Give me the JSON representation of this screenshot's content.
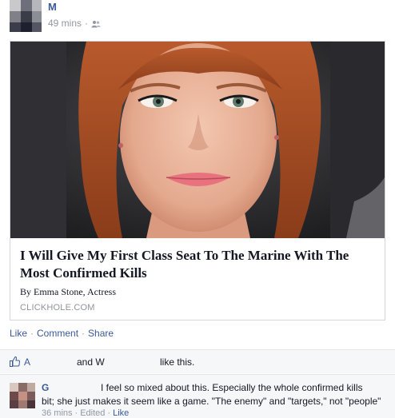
{
  "post": {
    "author": "M",
    "time": "49 mins",
    "separator": "·",
    "audience_icon": "friends-icon"
  },
  "card": {
    "title": "I Will Give My First Class Seat To The Marine With The Most Confirmed Kills",
    "byline": "By Emma Stone, Actress",
    "domain": "CLICKHOLE.COM"
  },
  "actions": {
    "like": "Like",
    "comment": "Comment",
    "share": "Share",
    "separator": "·"
  },
  "likes": {
    "name1": "A",
    "and": "and W",
    "tail": "like this.",
    "icon": "thumbs-up-icon"
  },
  "comment": {
    "author": "G",
    "line1": "I feel so mixed about this. Especially the whole confirmed kills",
    "line2": "bit; she just makes it seem like a game. \"The enemy\" and \"targets,\" not \"people\"",
    "time": "36 mins",
    "edited": "Edited",
    "like": "Like",
    "separator": "·"
  },
  "colors": {
    "link": "#3b5998",
    "meta": "#9197a3",
    "panel": "#f6f7f9"
  }
}
